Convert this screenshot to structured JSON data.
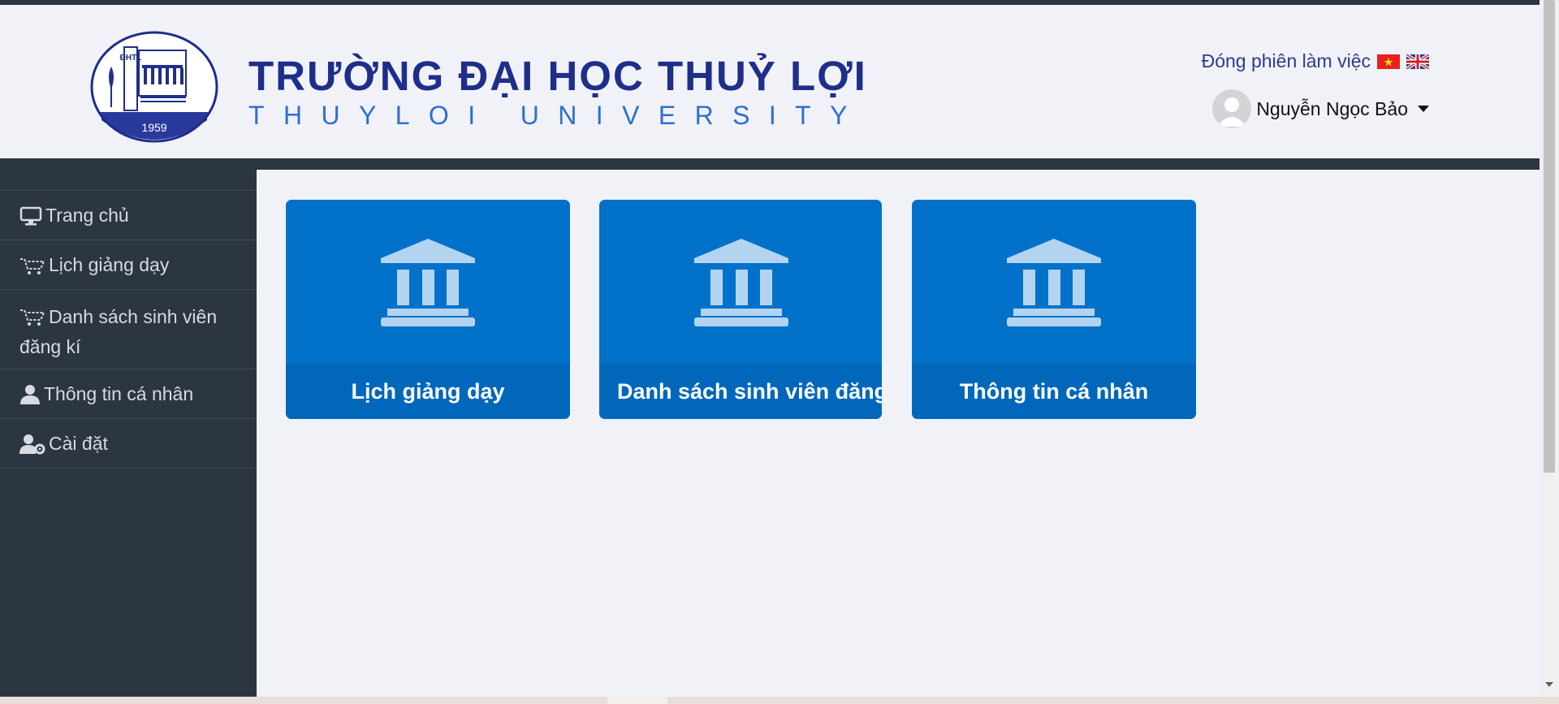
{
  "header": {
    "title_vi": "TRƯỜNG ĐẠI HỌC THUỶ LỢI",
    "title_en": "THUYLOI UNIVERSITY",
    "logo": {
      "initials": "ĐHTL",
      "year": "1959"
    },
    "session_link": "Đóng phiên làm việc",
    "flags": [
      "vietnam-flag-icon",
      "uk-flag-icon"
    ],
    "user_name": "Nguyễn Ngọc Bảo"
  },
  "sidebar": {
    "items": [
      {
        "label": "Trang chủ",
        "icon": "monitor-icon"
      },
      {
        "label": "Lịch giảng dạy",
        "icon": "cart-icon"
      },
      {
        "label": "Danh sách sinh viên đăng kí",
        "icon": "cart-icon"
      },
      {
        "label": "Thông tin cá nhân",
        "icon": "user-icon"
      },
      {
        "label": "Cài đặt",
        "icon": "user-cog-icon"
      }
    ]
  },
  "cards": [
    {
      "label": "Lịch giảng dạy",
      "icon": "university-icon"
    },
    {
      "label": "Danh sách sinh viên đăng kí",
      "icon": "university-icon"
    },
    {
      "label": "Thông tin cá nhân",
      "icon": "university-icon"
    }
  ],
  "colors": {
    "sidebar": "#2c3542",
    "card": "#0171c9",
    "card_footer": "#0167bb",
    "brand_dark": "#1e2e8a",
    "brand_light": "#2f6fd0"
  }
}
